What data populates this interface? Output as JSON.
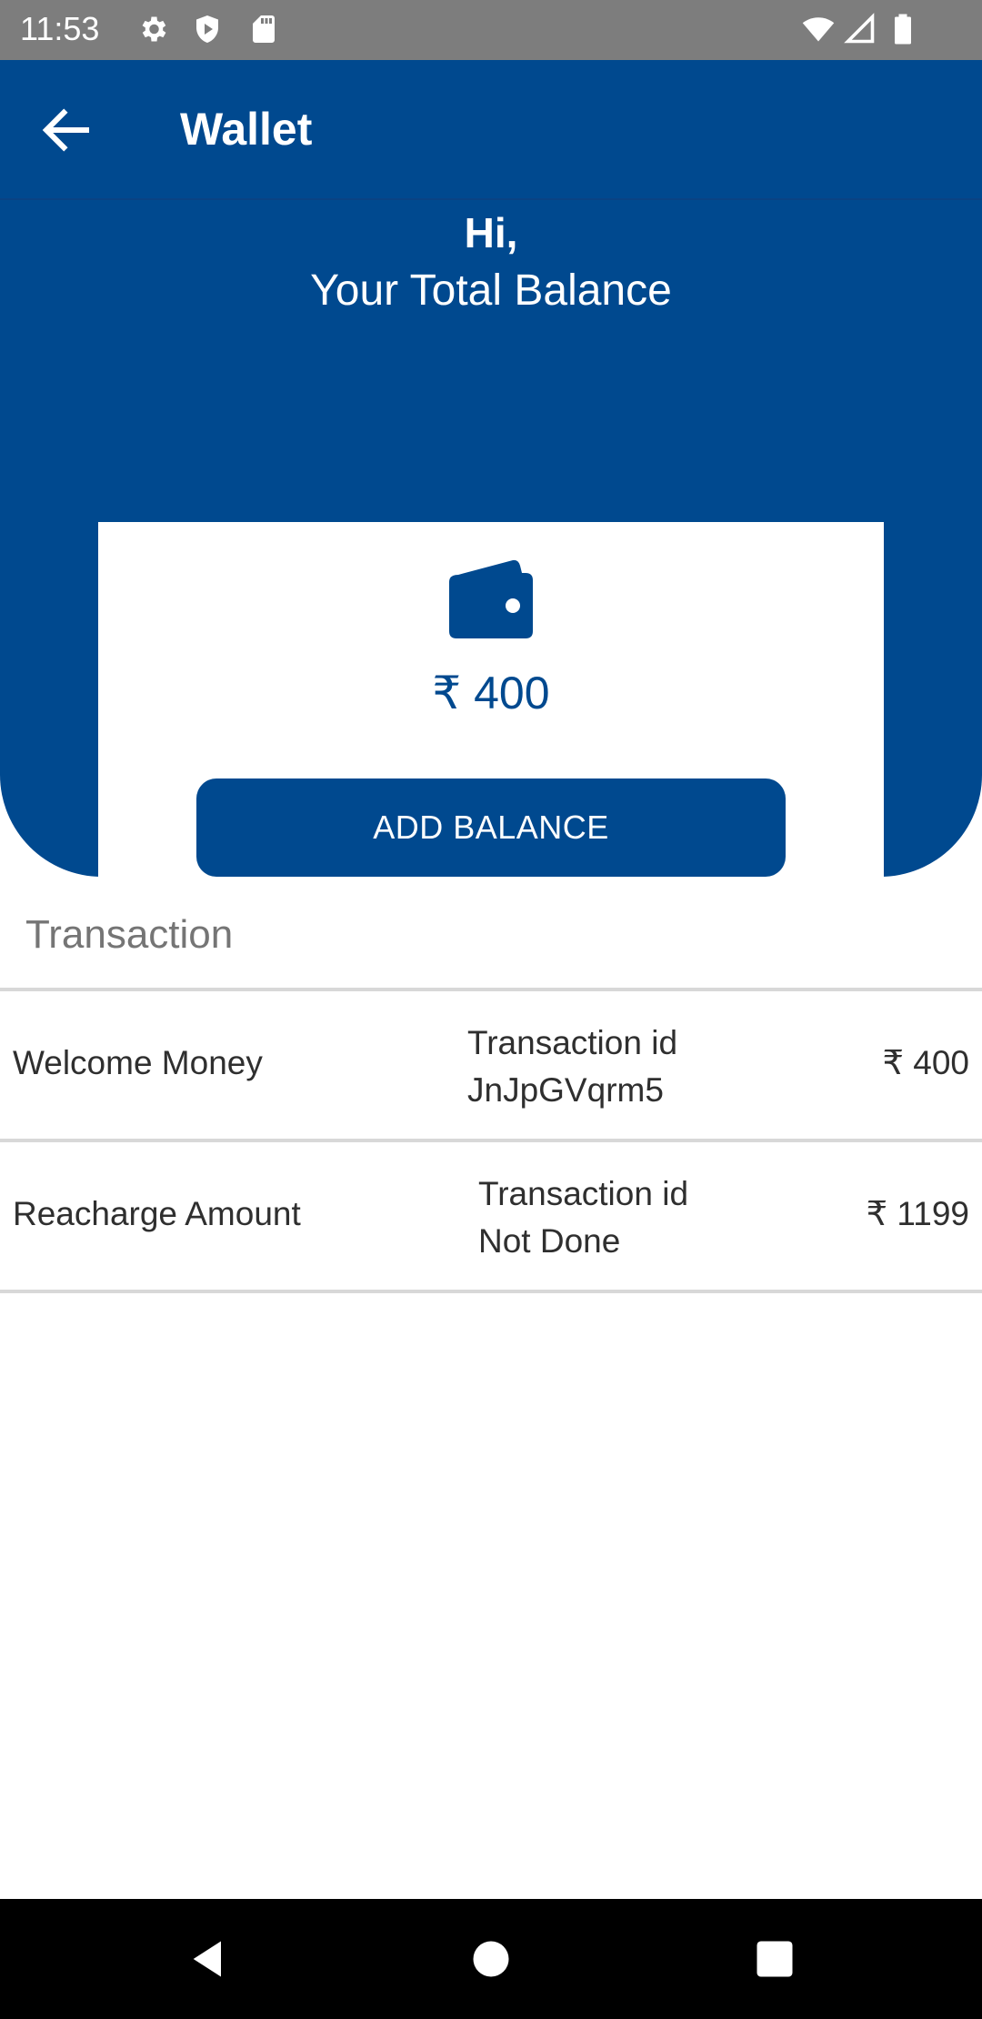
{
  "status_bar": {
    "time": "11:53",
    "left_icons": [
      "gear-icon",
      "shield-icon",
      "sd-card-icon"
    ],
    "right_icons": [
      "wifi-icon",
      "signal-icon",
      "battery-icon"
    ]
  },
  "app_bar": {
    "back_icon": "arrow-left-icon",
    "title": "Wallet"
  },
  "hero": {
    "greeting": "Hi,",
    "subtitle": "Your Total Balance"
  },
  "balance_card": {
    "icon": "wallet-icon",
    "amount": "₹ 400",
    "add_button_label": "ADD BALANCE"
  },
  "transactions": {
    "title": "Transaction",
    "items": [
      {
        "name": "Welcome Money",
        "id_label": "Transaction id",
        "id_value": "JnJpGVqrm5",
        "amount": "₹ 400"
      },
      {
        "name": "Reacharge Amount",
        "id_label": "Transaction id",
        "id_value": "Not Done",
        "amount": "₹ 1199"
      }
    ]
  },
  "nav_bar": {
    "buttons": [
      "back-triangle-icon",
      "home-circle-icon",
      "recents-square-icon"
    ]
  },
  "colors": {
    "primary": "#00498f",
    "status_bar": "#7d7d7d",
    "divider": "#d8d8d8",
    "section_title": "#757575"
  }
}
